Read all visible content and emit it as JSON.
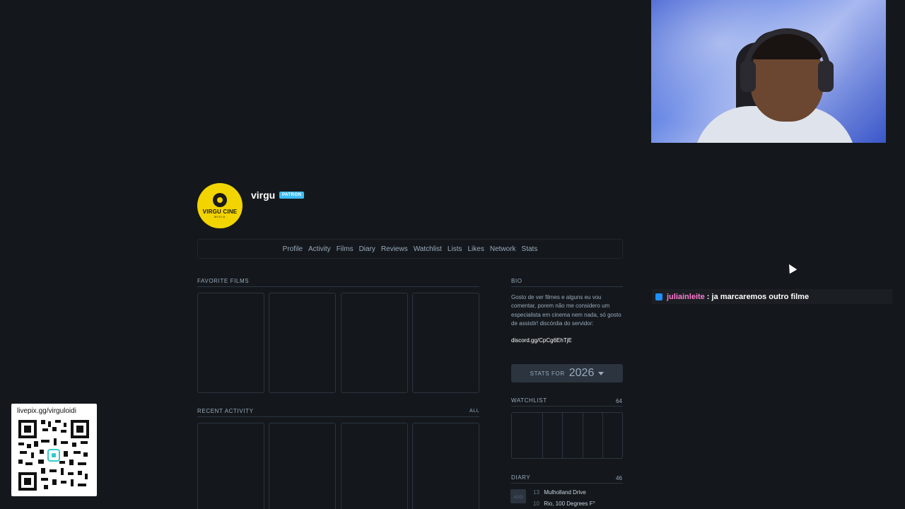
{
  "profile": {
    "avatar_brand": "VIRGU CINE",
    "avatar_sub": "MIDIA",
    "username": "virgu",
    "badge": "PATRON"
  },
  "nav": [
    "Profile",
    "Activity",
    "Films",
    "Diary",
    "Reviews",
    "Watchlist",
    "Lists",
    "Likes",
    "Network",
    "Stats"
  ],
  "sections": {
    "favorite_films": "FAVORITE FILMS",
    "recent_activity": "RECENT ACTIVITY",
    "recent_activity_all": "ALL",
    "bio": "BIO",
    "watchlist": "WATCHLIST",
    "watchlist_count": "64",
    "diary": "DIARY",
    "diary_count": "46"
  },
  "bio": {
    "text": "Gosto de ver filmes e alguns eu vou comentar, porem não me considero um especialista em cinema nem nada, só gosto de assistir! discórdia do servidor:",
    "link": "discord.gg/CpCg6EhTjE"
  },
  "stats_button": {
    "label": "STATS FOR",
    "year": "2026"
  },
  "diary": {
    "month": "AUG",
    "entries": [
      {
        "day": "13",
        "film": "Mulholland Drive"
      },
      {
        "day": "10",
        "film": "Rio, 100 Degrees F°"
      }
    ]
  },
  "chat": {
    "user": "juliainleite",
    "message": ": ja marcaremos outro filme"
  },
  "qr": {
    "url": "livepix.gg/virguloidi"
  },
  "colors": {
    "background": "#14181c",
    "patron": "#40bcf4",
    "avatar": "#f2d400",
    "chat_user": "#ff7bd3"
  }
}
